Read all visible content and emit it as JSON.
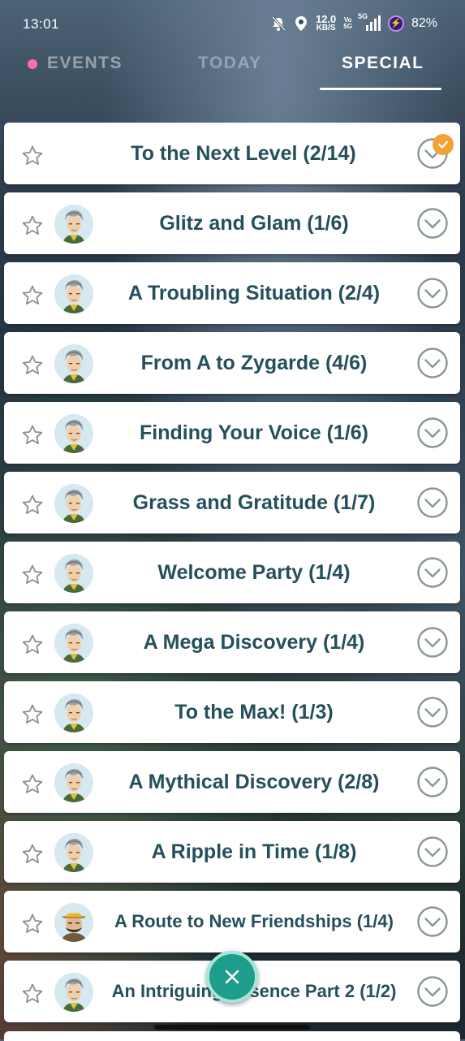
{
  "status_bar": {
    "time": "13:01",
    "net_speed_value": "12.0",
    "net_speed_unit": "KB/S",
    "volte_top": "Vo",
    "volte_bottom": "5G",
    "network": "5G",
    "battery_percent": "82%",
    "icons": [
      "mute-icon",
      "location-icon",
      "signal-icon",
      "battery-saver-icon"
    ]
  },
  "tabs": {
    "events": "EVENTS",
    "today": "TODAY",
    "special": "SPECIAL",
    "active": "SPECIAL"
  },
  "research": [
    {
      "title": "To the Next Level (2/14)",
      "avatar": "none",
      "completed": true
    },
    {
      "title": "Glitz and Glam (1/6)",
      "avatar": "professor-willow-avatar"
    },
    {
      "title": "A Troubling Situation (2/4)",
      "avatar": "professor-willow-avatar"
    },
    {
      "title": "From A to Zygarde (4/6)",
      "avatar": "professor-willow-avatar"
    },
    {
      "title": "Finding Your Voice (1/6)",
      "avatar": "professor-willow-avatar"
    },
    {
      "title": "Grass and Gratitude (1/7)",
      "avatar": "professor-willow-avatar"
    },
    {
      "title": "Welcome Party (1/4)",
      "avatar": "professor-willow-avatar"
    },
    {
      "title": "A Mega Discovery (1/4)",
      "avatar": "professor-willow-avatar"
    },
    {
      "title": "To the Max! (1/3)",
      "avatar": "professor-willow-avatar"
    },
    {
      "title": "A Mythical Discovery (2/8)",
      "avatar": "professor-willow-avatar"
    },
    {
      "title": "A Ripple in Time (1/8)",
      "avatar": "professor-willow-avatar"
    },
    {
      "title": "A Route to New Friendships (1/4)",
      "avatar": "hiker-avatar"
    },
    {
      "title": "An Intriguing Essence Part 2 (1/2)",
      "avatar": "professor-willow-avatar"
    }
  ],
  "close_button": "close-icon",
  "colors": {
    "title_text": "#24505c",
    "card_bg": "#ffffff",
    "badge": "#f0a236",
    "fab": "#1f9d8c",
    "events_dot": "#ff6ea8"
  }
}
